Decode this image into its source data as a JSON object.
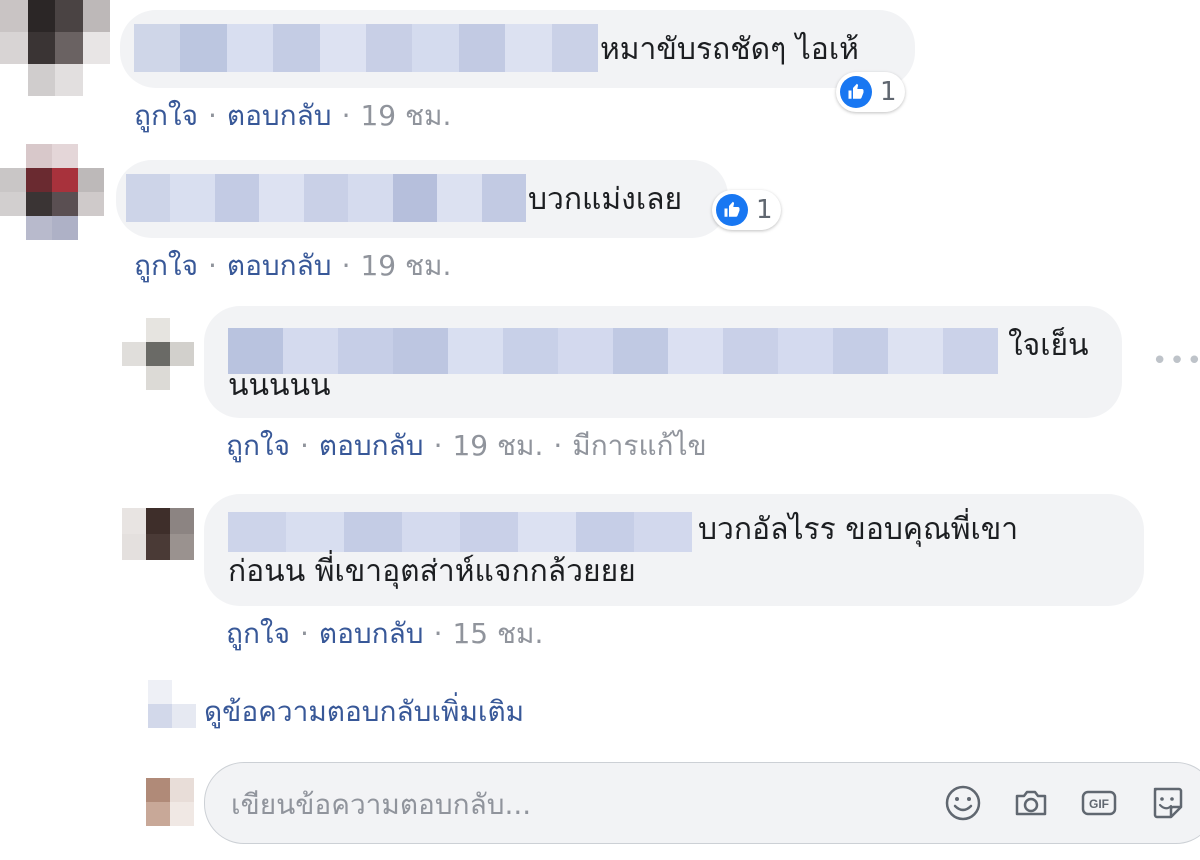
{
  "comments": [
    {
      "text": "หมาขับรถชัดๆ ไอเห้",
      "reaction_count": "1",
      "actions": {
        "like": "ถูกใจ",
        "reply": "ตอบกลับ",
        "time": "19 ชม."
      }
    },
    {
      "text": "บวกแม่งเลย",
      "reaction_count": "1",
      "actions": {
        "like": "ถูกใจ",
        "reply": "ตอบกลับ",
        "time": "19 ชม."
      }
    }
  ],
  "replies": [
    {
      "text_line1": "ใจเย็น",
      "text_line2": "นนนนน",
      "actions": {
        "like": "ถูกใจ",
        "reply": "ตอบกลับ",
        "time": "19 ชม.",
        "edited": "มีการแก้ไข"
      },
      "more": "•••"
    },
    {
      "text_line1": "บวกอัลไรร ขอบคุณพี่เขา",
      "text_line2": "ก่อนน พี่เขาอุตส่าห์แจกกล้วยยย",
      "actions": {
        "like": "ถูกใจ",
        "reply": "ตอบกลับ",
        "time": "15 ชม."
      }
    }
  ],
  "view_more_replies": "ดูข้อความตอบกลับเพิ่มเติม",
  "reply_input": {
    "placeholder": "เขียนข้อความตอบกลับ..."
  },
  "reply_tools": [
    "emoji-icon",
    "camera-icon",
    "gif-icon",
    "sticker-icon"
  ],
  "gif_label": "GIF",
  "colors": {
    "link": "#385898",
    "meta": "#90949c",
    "bubble": "#f2f3f5",
    "like": "#1877f2"
  }
}
